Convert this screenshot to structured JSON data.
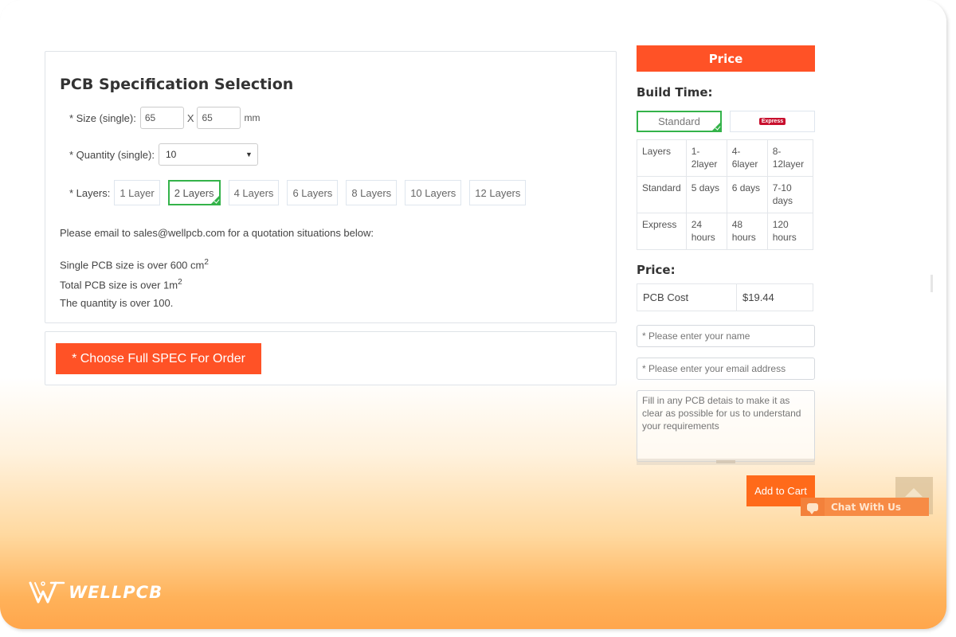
{
  "spec": {
    "title": "PCB Specification Selection",
    "size_label": "* Size (single):",
    "size_width": "65",
    "size_sep": "X",
    "size_height": "65",
    "size_unit": "mm",
    "quantity_label": "* Quantity (single):",
    "quantity_value": "10",
    "quantity_arrow": "▼",
    "layers_label": "* Layers:",
    "layers": [
      {
        "label": "1 Layer",
        "selected": false
      },
      {
        "label": "2 Layers",
        "selected": true
      },
      {
        "label": "4 Layers",
        "selected": false
      },
      {
        "label": "6 Layers",
        "selected": false
      },
      {
        "label": "8 Layers",
        "selected": false
      },
      {
        "label": "10 Layers",
        "selected": false
      },
      {
        "label": "12 Layers",
        "selected": false
      }
    ],
    "notice": "Please email to sales@wellpcb.com for a quotation situations below:",
    "conditions": [
      {
        "text": "Single PCB size is over 600 cm",
        "sup": "2"
      },
      {
        "text": "Total PCB size is over 1m",
        "sup": "2"
      },
      {
        "text": "The quantity is over 100.",
        "sup": ""
      }
    ]
  },
  "order": {
    "button_label": "* Choose Full SPEC For Order"
  },
  "sidebar": {
    "price_header": "Price",
    "build_time_title": "Build Time:",
    "build_options": {
      "standard": "Standard",
      "express": "Express",
      "selected": "Standard"
    },
    "build_table": [
      [
        "Layers",
        "1-2layer",
        "4-6layer",
        "8-12layer"
      ],
      [
        "Standard",
        "5 days",
        "6 days",
        "7-10 days"
      ],
      [
        "Express",
        "24 hours",
        "48 hours",
        "120 hours"
      ]
    ],
    "price_title": "Price:",
    "cost_label": "PCB Cost",
    "cost_value": "$19.44",
    "name_placeholder": "* Please enter your name",
    "email_placeholder": "* Please enter your email address",
    "details_placeholder": "Fill in any PCB detais to make it as clear as possible for us to understand your requirements",
    "add_to_cart_label": "Add to Cart"
  },
  "chat": {
    "label": "Chat With Us"
  },
  "brand": {
    "logo_text": "WELLPCB",
    "accent_color": "#ff5226",
    "selected_color": "#34b34a"
  }
}
